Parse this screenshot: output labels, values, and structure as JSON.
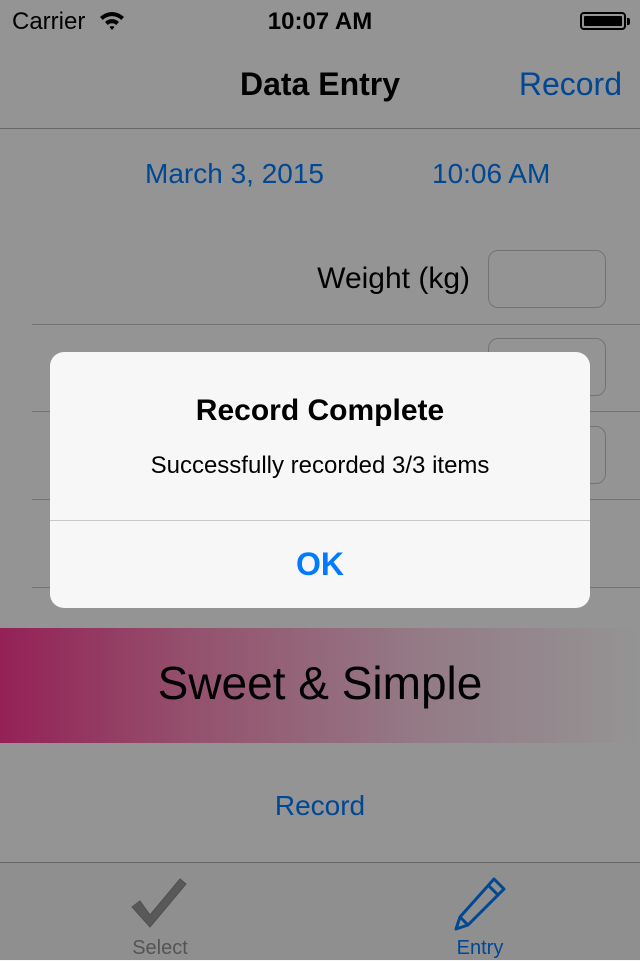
{
  "status_bar": {
    "carrier": "Carrier",
    "time": "10:07 AM",
    "wifi_icon": "wifi-icon",
    "battery_icon": "battery-icon"
  },
  "nav": {
    "title": "Data Entry",
    "right_button": "Record"
  },
  "entry": {
    "date": "March 3, 2015",
    "time": "10:06 AM",
    "rows": [
      {
        "label": "Weight (kg)",
        "value": ""
      },
      {
        "label": "",
        "value": ""
      },
      {
        "label": "",
        "value": ""
      }
    ]
  },
  "banner": {
    "text": "Sweet & Simple",
    "gradient_start": "#ff3a96",
    "gradient_end": "#ffffff"
  },
  "footer": {
    "record_label": "Record"
  },
  "tabbar": {
    "tabs": [
      {
        "label": "Select",
        "icon": "checkmark-icon",
        "selected": false
      },
      {
        "label": "Entry",
        "icon": "pencil-icon",
        "selected": true
      }
    ]
  },
  "alert": {
    "title": "Record Complete",
    "message": "Successfully recorded 3/3 items",
    "button": "OK"
  },
  "colors": {
    "accent": "#007aff",
    "overlay": "rgba(0,0,0,0.42)"
  }
}
